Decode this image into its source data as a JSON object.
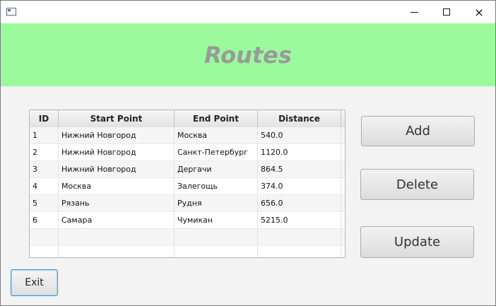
{
  "window": {
    "icon": "app-window-icon",
    "controls": {
      "minimize": "minimize-icon",
      "maximize": "maximize-icon",
      "close": "×"
    }
  },
  "header": {
    "title": "Routes",
    "background": "#9bfa9b",
    "title_color": "#9a9a9a"
  },
  "table": {
    "columns": [
      "ID",
      "Start Point",
      "End Point",
      "Distance"
    ],
    "rows": [
      [
        "1",
        "Нижний Новгород",
        "Москва",
        "540.0"
      ],
      [
        "2",
        "Нижний Новгород",
        "Санкт-Петербург",
        "1120.0"
      ],
      [
        "3",
        "Нижний Новгород",
        "Дергачи",
        "864.5"
      ],
      [
        "4",
        "Москва",
        "Залегощь",
        "374.0"
      ],
      [
        "5",
        "Рязань",
        "Рудня",
        "656.0"
      ],
      [
        "6",
        "Самара",
        "Чумикан",
        "5215.0"
      ]
    ]
  },
  "buttons": {
    "add": "Add",
    "delete": "Delete",
    "update": "Update",
    "exit": "Exit"
  },
  "colors": {
    "focus_border": "#3a9ad9"
  }
}
